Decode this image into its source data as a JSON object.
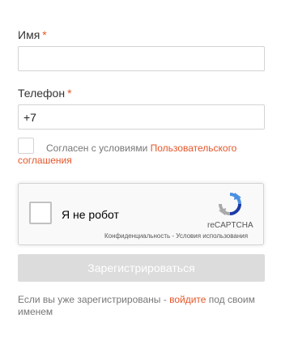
{
  "form": {
    "name_label": "Имя",
    "name_value": "",
    "phone_label": "Телефон",
    "phone_value": "+7",
    "required_marker": "*",
    "agree_text": "Согласен с условиями ",
    "agree_link_part1": "Пользовательского",
    "agree_link_part2": "соглашения",
    "submit_label": "Зарегистрироваться",
    "login_note_prefix": "Если вы уже зарегистрированы - ",
    "login_link": "войдите",
    "login_note_suffix": " под своим именем"
  },
  "recaptcha": {
    "label": "Я не робот",
    "brand": "reCAPTCHA",
    "privacy": "Конфиденциальность",
    "separator": " - ",
    "terms": "Условия использования"
  },
  "colors": {
    "accent": "#e5562a",
    "disabled_button": "#dcdcdc",
    "muted_text": "#777777",
    "border": "#d3d3d3"
  }
}
